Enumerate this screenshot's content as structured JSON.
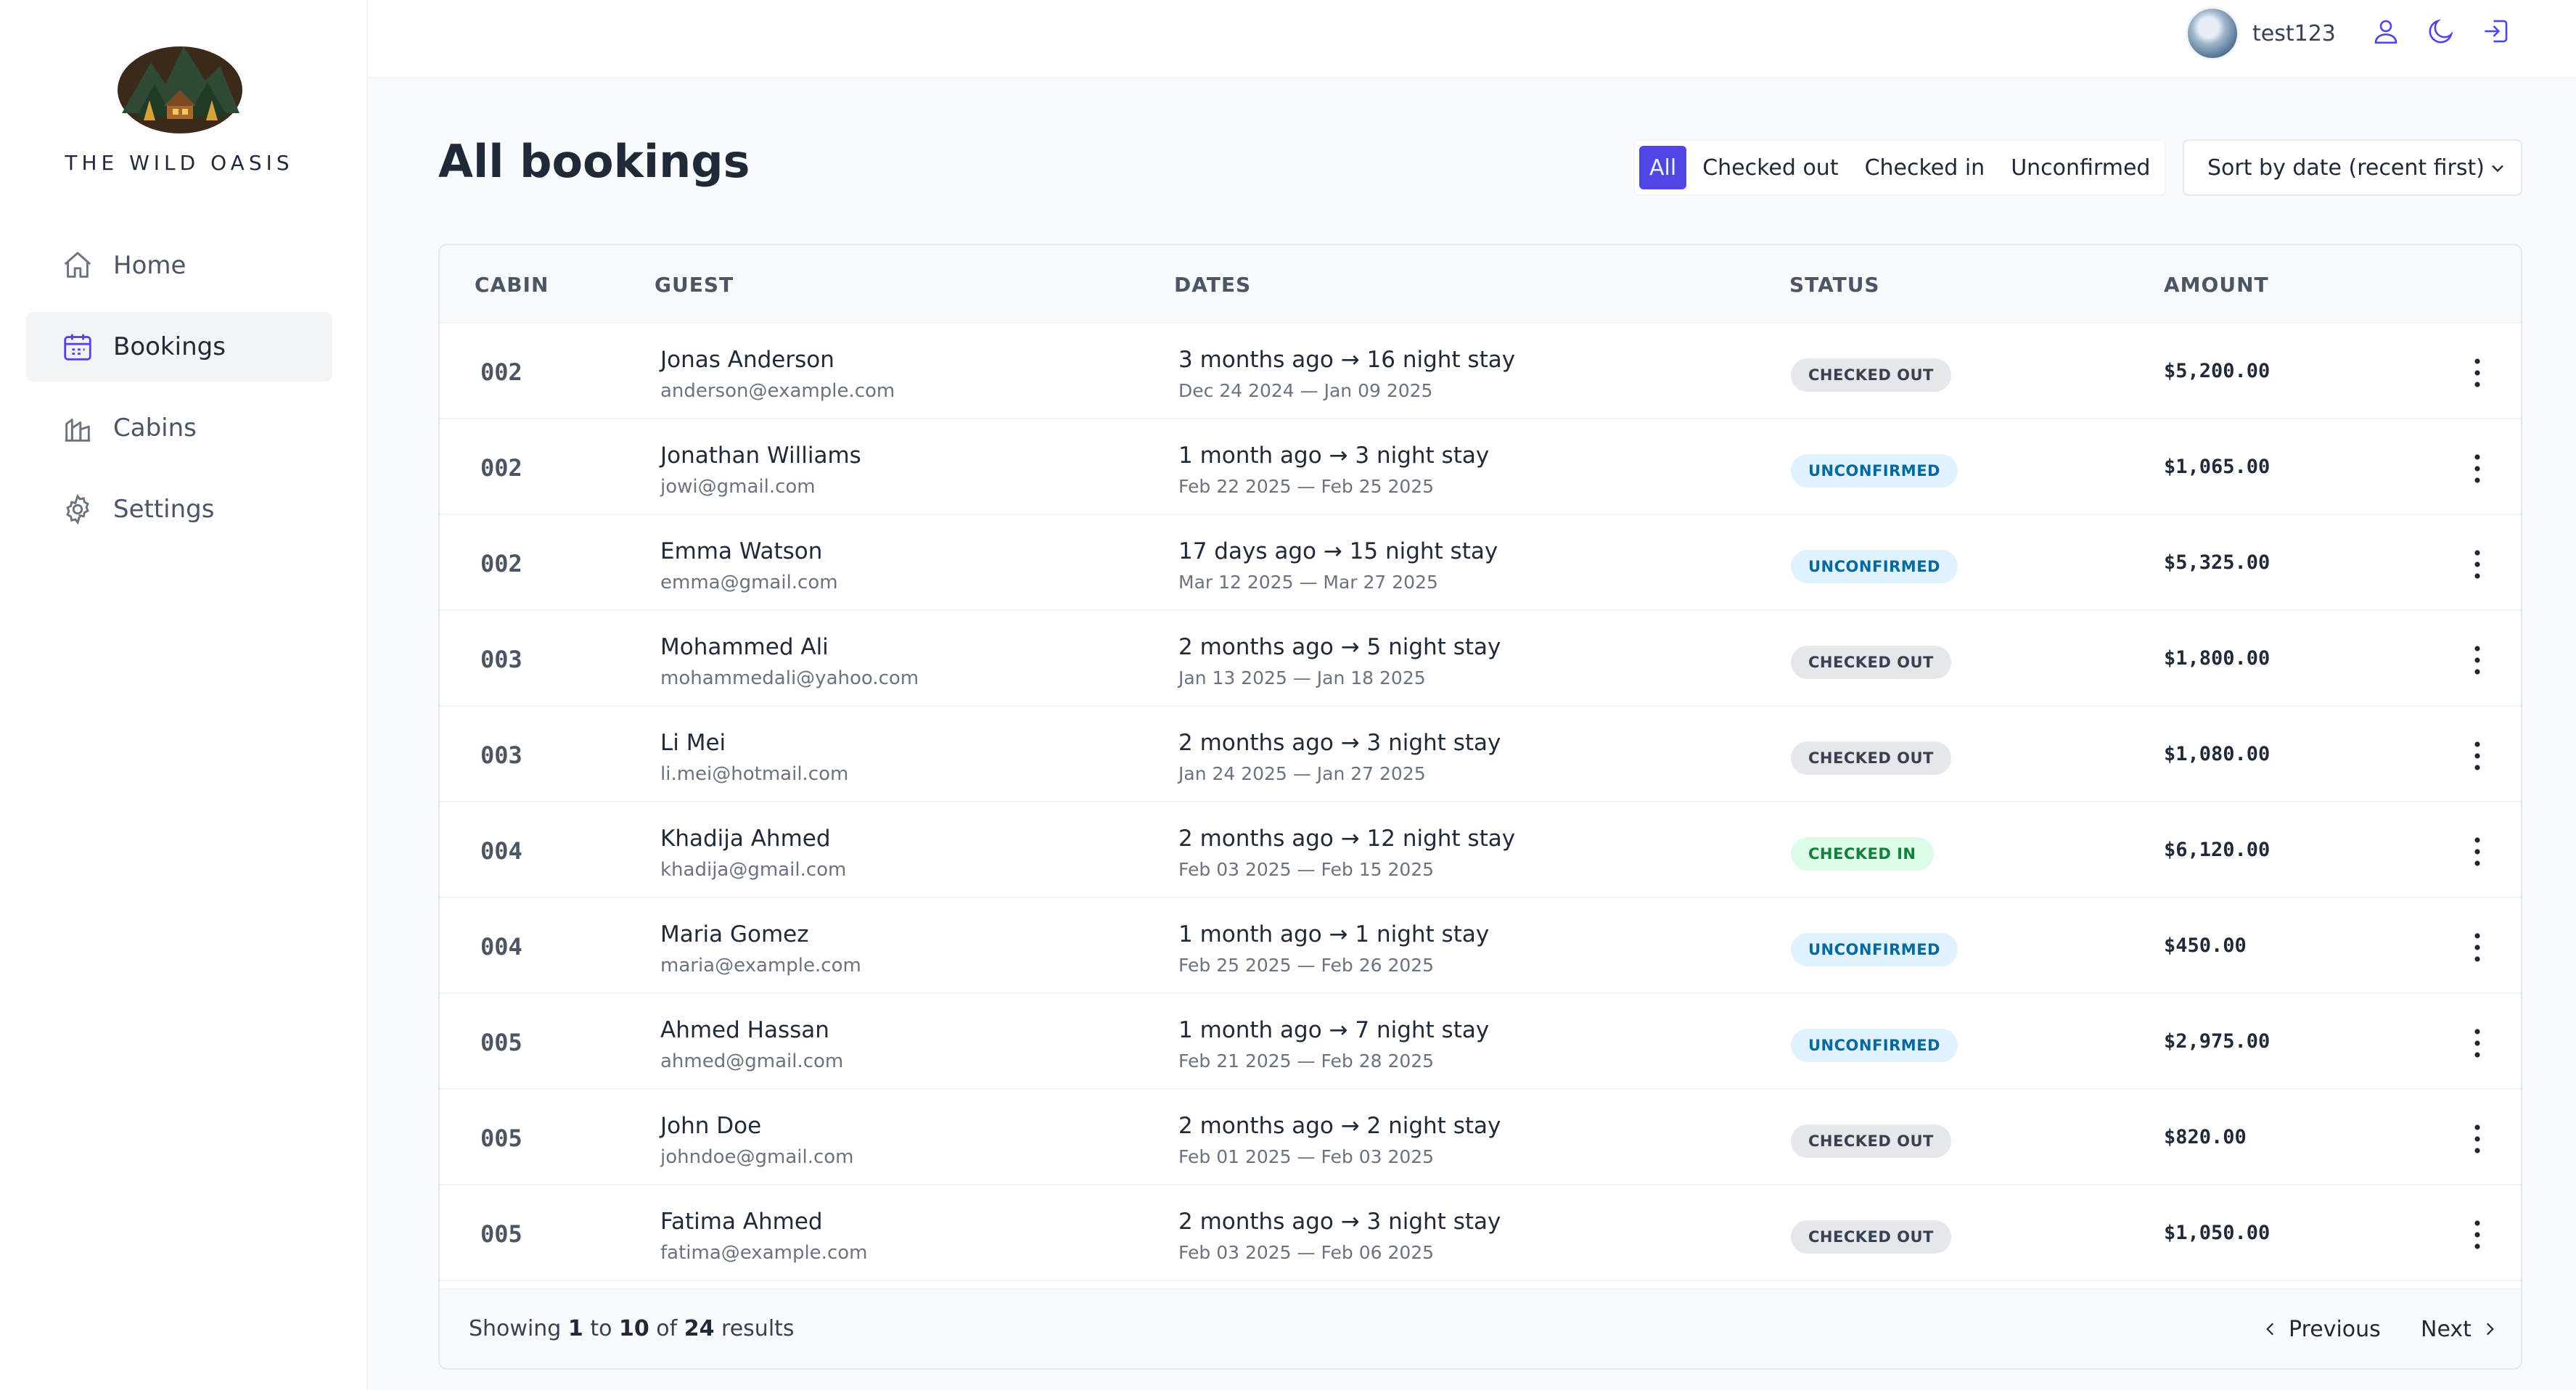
{
  "brand": {
    "name": "THE WILD OASIS"
  },
  "sidebar": {
    "items": [
      {
        "label": "Home",
        "icon": "home-icon"
      },
      {
        "label": "Bookings",
        "icon": "calendar-icon",
        "active": true
      },
      {
        "label": "Cabins",
        "icon": "cabins-icon"
      },
      {
        "label": "Settings",
        "icon": "gear-icon"
      }
    ]
  },
  "header": {
    "username": "test123",
    "icons": [
      "user-icon",
      "moon-icon",
      "logout-icon"
    ]
  },
  "page": {
    "title": "All bookings"
  },
  "filter": {
    "options": [
      "All",
      "Checked out",
      "Checked in",
      "Unconfirmed"
    ],
    "active": "All"
  },
  "sort": {
    "value": "Sort by date (recent first)"
  },
  "table": {
    "columns": [
      "CABIN",
      "GUEST",
      "DATES",
      "STATUS",
      "AMOUNT"
    ],
    "rows": [
      {
        "cabin": "002",
        "name": "Jonas Anderson",
        "email": "anderson@example.com",
        "dates_main": "3 months ago → 16 night stay",
        "dates_sub": "Dec 24 2024 — Jan 09 2025",
        "status": "CHECKED OUT",
        "status_type": "checked-out",
        "amount": "$5,200.00"
      },
      {
        "cabin": "002",
        "name": "Jonathan Williams",
        "email": "jowi@gmail.com",
        "dates_main": "1 month ago → 3 night stay",
        "dates_sub": "Feb 22 2025 — Feb 25 2025",
        "status": "UNCONFIRMED",
        "status_type": "unconfirmed",
        "amount": "$1,065.00"
      },
      {
        "cabin": "002",
        "name": "Emma Watson",
        "email": "emma@gmail.com",
        "dates_main": "17 days ago → 15 night stay",
        "dates_sub": "Mar 12 2025 — Mar 27 2025",
        "status": "UNCONFIRMED",
        "status_type": "unconfirmed",
        "amount": "$5,325.00"
      },
      {
        "cabin": "003",
        "name": "Mohammed Ali",
        "email": "mohammedali@yahoo.com",
        "dates_main": "2 months ago → 5 night stay",
        "dates_sub": "Jan 13 2025 — Jan 18 2025",
        "status": "CHECKED OUT",
        "status_type": "checked-out",
        "amount": "$1,800.00"
      },
      {
        "cabin": "003",
        "name": "Li Mei",
        "email": "li.mei@hotmail.com",
        "dates_main": "2 months ago → 3 night stay",
        "dates_sub": "Jan 24 2025 — Jan 27 2025",
        "status": "CHECKED OUT",
        "status_type": "checked-out",
        "amount": "$1,080.00"
      },
      {
        "cabin": "004",
        "name": "Khadija Ahmed",
        "email": "khadija@gmail.com",
        "dates_main": "2 months ago → 12 night stay",
        "dates_sub": "Feb 03 2025 — Feb 15 2025",
        "status": "CHECKED IN",
        "status_type": "checked-in",
        "amount": "$6,120.00"
      },
      {
        "cabin": "004",
        "name": "Maria Gomez",
        "email": "maria@example.com",
        "dates_main": "1 month ago → 1 night stay",
        "dates_sub": "Feb 25 2025 — Feb 26 2025",
        "status": "UNCONFIRMED",
        "status_type": "unconfirmed",
        "amount": "$450.00"
      },
      {
        "cabin": "005",
        "name": "Ahmed Hassan",
        "email": "ahmed@gmail.com",
        "dates_main": "1 month ago → 7 night stay",
        "dates_sub": "Feb 21 2025 — Feb 28 2025",
        "status": "UNCONFIRMED",
        "status_type": "unconfirmed",
        "amount": "$2,975.00"
      },
      {
        "cabin": "005",
        "name": "John Doe",
        "email": "johndoe@gmail.com",
        "dates_main": "2 months ago → 2 night stay",
        "dates_sub": "Feb 01 2025 — Feb 03 2025",
        "status": "CHECKED OUT",
        "status_type": "checked-out",
        "amount": "$820.00"
      },
      {
        "cabin": "005",
        "name": "Fatima Ahmed",
        "email": "fatima@example.com",
        "dates_main": "2 months ago → 3 night stay",
        "dates_sub": "Feb 03 2025 — Feb 06 2025",
        "status": "CHECKED OUT",
        "status_type": "checked-out",
        "amount": "$1,050.00"
      }
    ]
  },
  "pagination": {
    "showing_prefix": "Showing",
    "from": "1",
    "to_word": "to",
    "to": "10",
    "of_word": "of",
    "total": "24",
    "suffix": "results",
    "previous": "Previous",
    "next": "Next"
  },
  "colors": {
    "accent": "#4f46e5",
    "checked_out_bg": "#e5e7eb",
    "unconfirmed_bg": "#e0f2fe",
    "checked_in_bg": "#dcfce7"
  }
}
